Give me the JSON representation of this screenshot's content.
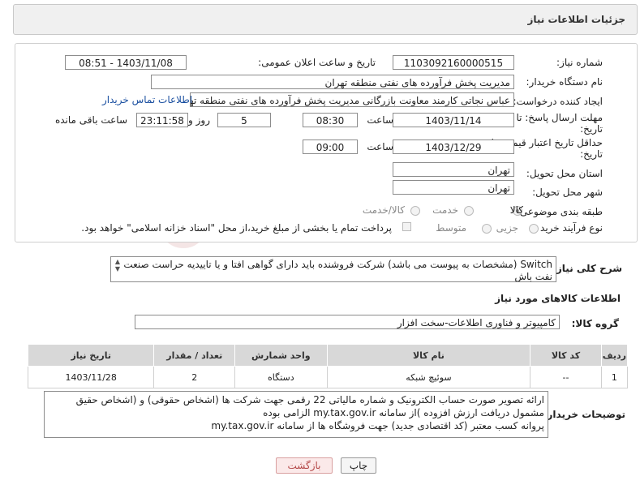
{
  "header": {
    "title": "جزئیات اطلاعات نیاز"
  },
  "form": {
    "need_number_label": "شماره نیاز:",
    "need_number": "1103092160000515",
    "announce_label": "تاریخ و ساعت اعلان عمومی:",
    "announce_value": "1403/11/08 - 08:51",
    "buyer_org_label": "نام دستگاه خریدار:",
    "buyer_org": "مدیریت پخش فرآورده های نفتی منطقه تهران",
    "creator_label": "ایجاد کننده درخواست:",
    "creator": "عباس نجاتی کارمند معاونت بازرگانی مدیریت پخش فرآورده های نفتی منطقه تهران",
    "contact_link": "اطلاعات تماس خریدار",
    "deadline_label_1": "مهلت ارسال پاسخ: تا",
    "deadline_label_2": "تاریخ:",
    "deadline_date": "1403/11/14",
    "time_label": "ساعت",
    "deadline_time": "08:30",
    "days_value": "5",
    "days_label": "روز و",
    "remaining_time": "23:11:58",
    "remaining_label": "ساعت باقی مانده",
    "validity_label_1": "حداقل تاریخ اعتبار قیمت: تا",
    "validity_label_2": "تاریخ:",
    "validity_date": "1403/12/29",
    "validity_time": "09:00",
    "province_label": "استان محل تحویل:",
    "province": "تهران",
    "city_label": "شهر محل تحویل:",
    "city": "تهران",
    "category_label": "طبقه بندی موضوعی:",
    "category_options": [
      "کالا",
      "خدمت",
      "کالا/خدمت"
    ],
    "process_label": "نوع فرآیند خرید :",
    "process_options": [
      "جزیی",
      "متوسط"
    ],
    "payment_note": "پرداخت تمام یا بخشی از مبلغ خرید،از محل \"اسناد خزانه اسلامی\" خواهد بود."
  },
  "description": {
    "label": "شرح کلی نیاز:",
    "text": "Switch (مشخصات به پیوست می باشد) شرکت فروشنده باید دارای گواهی افتا و یا تاییدیه حراست صنعت نفت باش"
  },
  "goods": {
    "section_title": "اطلاعات کالاهای مورد نیاز",
    "group_label": "گروه کالا:",
    "group_value": "کامپیوتر و فناوری اطلاعات-سخت افزار",
    "columns": [
      "ردیف",
      "کد کالا",
      "نام کالا",
      "واحد شمارش",
      "تعداد / مقدار",
      "تاریخ نیاز"
    ],
    "rows": [
      {
        "row": "1",
        "code": "--",
        "name": "سوئیچ شبکه",
        "unit": "دستگاه",
        "qty": "2",
        "date": "1403/11/28"
      }
    ]
  },
  "buyer_notes": {
    "label": "توضیحات خریدار:",
    "line1": "ارائه  تصویر صورت حساب الکترونیک و شماره مالیاتی 22 رقمی  جهت شرکت ها (اشخاص حقوقی) و (اشخاص حقیق",
    "line2": "مشمول دریافت ارزش افزوده )از سامانه my.tax.gov.ir  الزامی بوده",
    "line3": "پروانه کسب معتبر (کد اقتصادی جدید) جهت فروشگاه ها از سامانه my.tax.gov.ir"
  },
  "buttons": {
    "print": "چاپ",
    "back": "بازگشت"
  },
  "watermark": "AriaTender.neT"
}
